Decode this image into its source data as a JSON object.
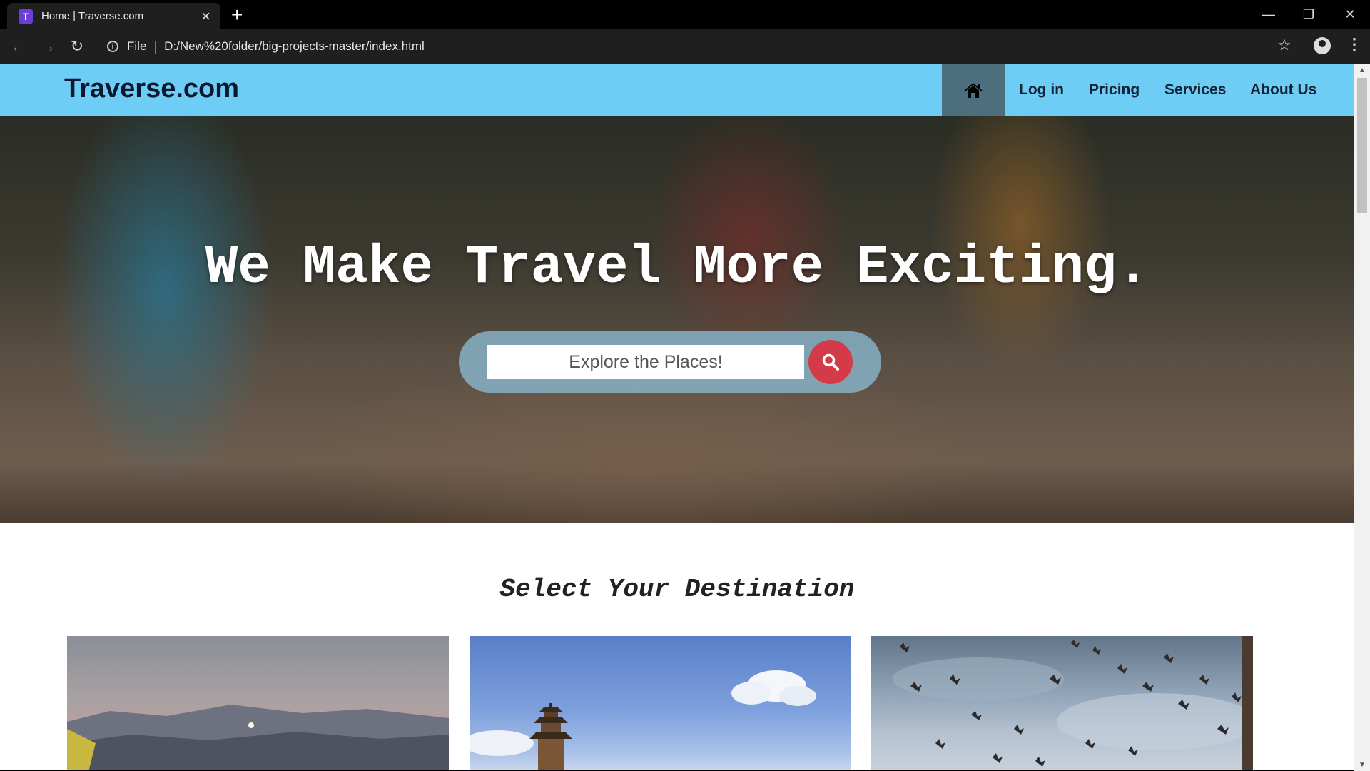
{
  "browser": {
    "tab_title": "Home | Traverse.com",
    "favicon_letter": "T",
    "address_scheme": "File",
    "address_url": "D:/New%20folder/big-projects-master/index.html"
  },
  "site": {
    "brand": "Traverse.com",
    "nav": {
      "login": "Log in",
      "pricing": "Pricing",
      "services": "Services",
      "about": "About Us"
    },
    "hero": {
      "title": "We Make Travel More Exciting.",
      "search_placeholder": "Explore the Places!"
    },
    "section_title": "Select Your Destination"
  },
  "icons": {
    "home": "home-icon",
    "search": "search-icon"
  },
  "colors": {
    "navbar": "#6ecdf5",
    "nav_active": "#4d6f7d",
    "search_button": "#d23b47",
    "brand_text": "#0b1830"
  }
}
